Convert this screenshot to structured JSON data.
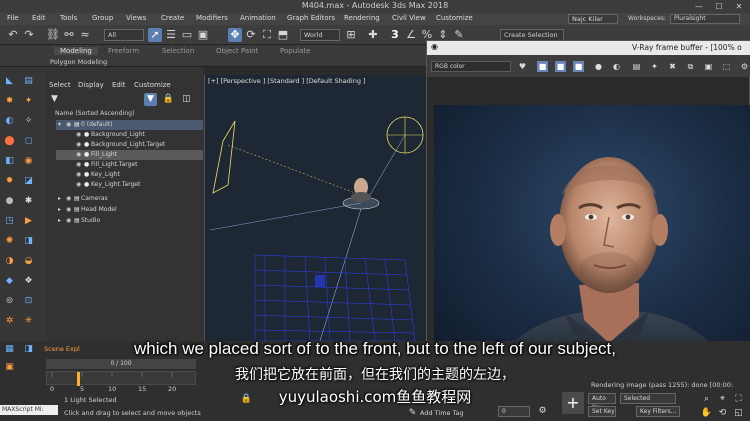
{
  "window": {
    "title": "M404.max - Autodesk 3ds Max 2018",
    "minimize": "—",
    "maximize": "☐",
    "close": "✕"
  },
  "menu": {
    "items": [
      "File",
      "Edit",
      "Tools",
      "Group",
      "Views",
      "Create",
      "Modifiers",
      "Animation",
      "Graph Editors",
      "Rendering",
      "Civil View",
      "Customize"
    ],
    "user": "Najc Kilar",
    "workspaces_label": "Workspaces:",
    "workspace": "Pluralsight"
  },
  "toolbar": {
    "selection_filter": "All",
    "reference_coord": "World",
    "selection_set": "Create Selection Se"
  },
  "ribbon": {
    "tabs": [
      "Modeling",
      "Freeform",
      "Selection",
      "Object Paint",
      "Populate"
    ],
    "active_tab": "Modeling",
    "subtitle": "Polygon Modeling"
  },
  "explorer": {
    "menu": [
      "Select",
      "Display",
      "Edit",
      "Customize"
    ],
    "column": "Name (Sorted Ascending)",
    "rows": [
      {
        "label": "0 (default)",
        "indent": 0
      },
      {
        "label": "Background_Light",
        "indent": 1
      },
      {
        "label": "Background_Light.Target",
        "indent": 1
      },
      {
        "label": "Fill_Light",
        "indent": 1
      },
      {
        "label": "Fill_Light.Target",
        "indent": 1
      },
      {
        "label": "Key_Light",
        "indent": 1
      },
      {
        "label": "Key_Light.Target",
        "indent": 1
      },
      {
        "label": "Cameras",
        "indent": 0
      },
      {
        "label": "Head Model",
        "indent": 0
      },
      {
        "label": "Studio",
        "indent": 0
      }
    ]
  },
  "viewport": {
    "label": "[+] [Perspective ] [Standard ] [Default Shading ]"
  },
  "vray": {
    "title": "V-Ray frame buffer - [100% o",
    "channel": "RGB color",
    "status": "Rendering image (pass 1255): done [00:00:"
  },
  "bottom": {
    "scene_explorer_label": "Scene Expl",
    "frame": "0 / 100",
    "ticks": [
      "0",
      "5",
      "10",
      "15",
      "20"
    ],
    "light_selected": "1 Light Selected",
    "hint": "Click and drag to select and move objects",
    "maxscript": "MAXScript Mi:",
    "add_time_tag": "Add Time Tag",
    "auto_key": "Auto Key",
    "set_key": "Set Key",
    "selected": "Selected",
    "key_filters": "Key Filters...",
    "frame_value": "0"
  },
  "subtitles": {
    "english": "which we placed sort of to the front, but to the left of our subject,",
    "chinese": "我们把它放在前面，但在我们的主题的左边，",
    "watermark": "yuyulaoshi.com鱼鱼教程网"
  },
  "colors": {
    "accent": "#5a7fb0",
    "orange": "#ff9b3a",
    "light_yellow": "#f0e060"
  }
}
